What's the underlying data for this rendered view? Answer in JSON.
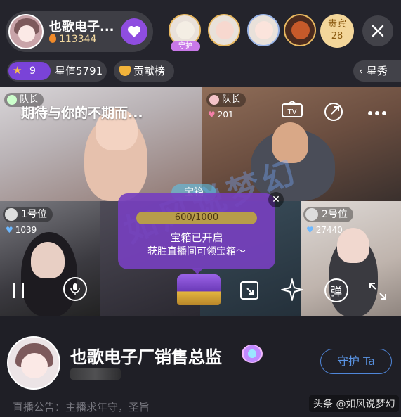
{
  "header": {
    "host_name": "也歌电子...",
    "host_fans": "113344",
    "guard_tag": "守护",
    "vip_label": "贵宾",
    "vip_count": "28"
  },
  "stats_bar": {
    "level": "9",
    "star_value": "星值5791",
    "contribution": "贡献榜",
    "xingxiu": "星秀"
  },
  "video": {
    "captain_label": "队长",
    "pk_title": "期待与你的不期而...",
    "team2_hearts": "201",
    "seat1_label": "1号位",
    "seat1_hearts": "1039",
    "seat2_label": "2号位",
    "seat2_hearts": "27440",
    "danmaku_label": "弹",
    "chest_badge": "宝箱",
    "chest_progress": "600/1000",
    "chest_line1": "宝箱已开启",
    "chest_line2": "获胜直播间可领宝箱～",
    "watermark": "如风说梦幻"
  },
  "profile": {
    "name": "也歌电子厂销售总监",
    "guard_button": "守护 Ta",
    "notice": "直播公告：主播求年守，圣旨",
    "source": "头条 @如风说梦幻"
  },
  "colors": {
    "accent_purple": "#8f4de0",
    "guard_blue": "#4f86d9",
    "gold": "#f3d69a"
  }
}
